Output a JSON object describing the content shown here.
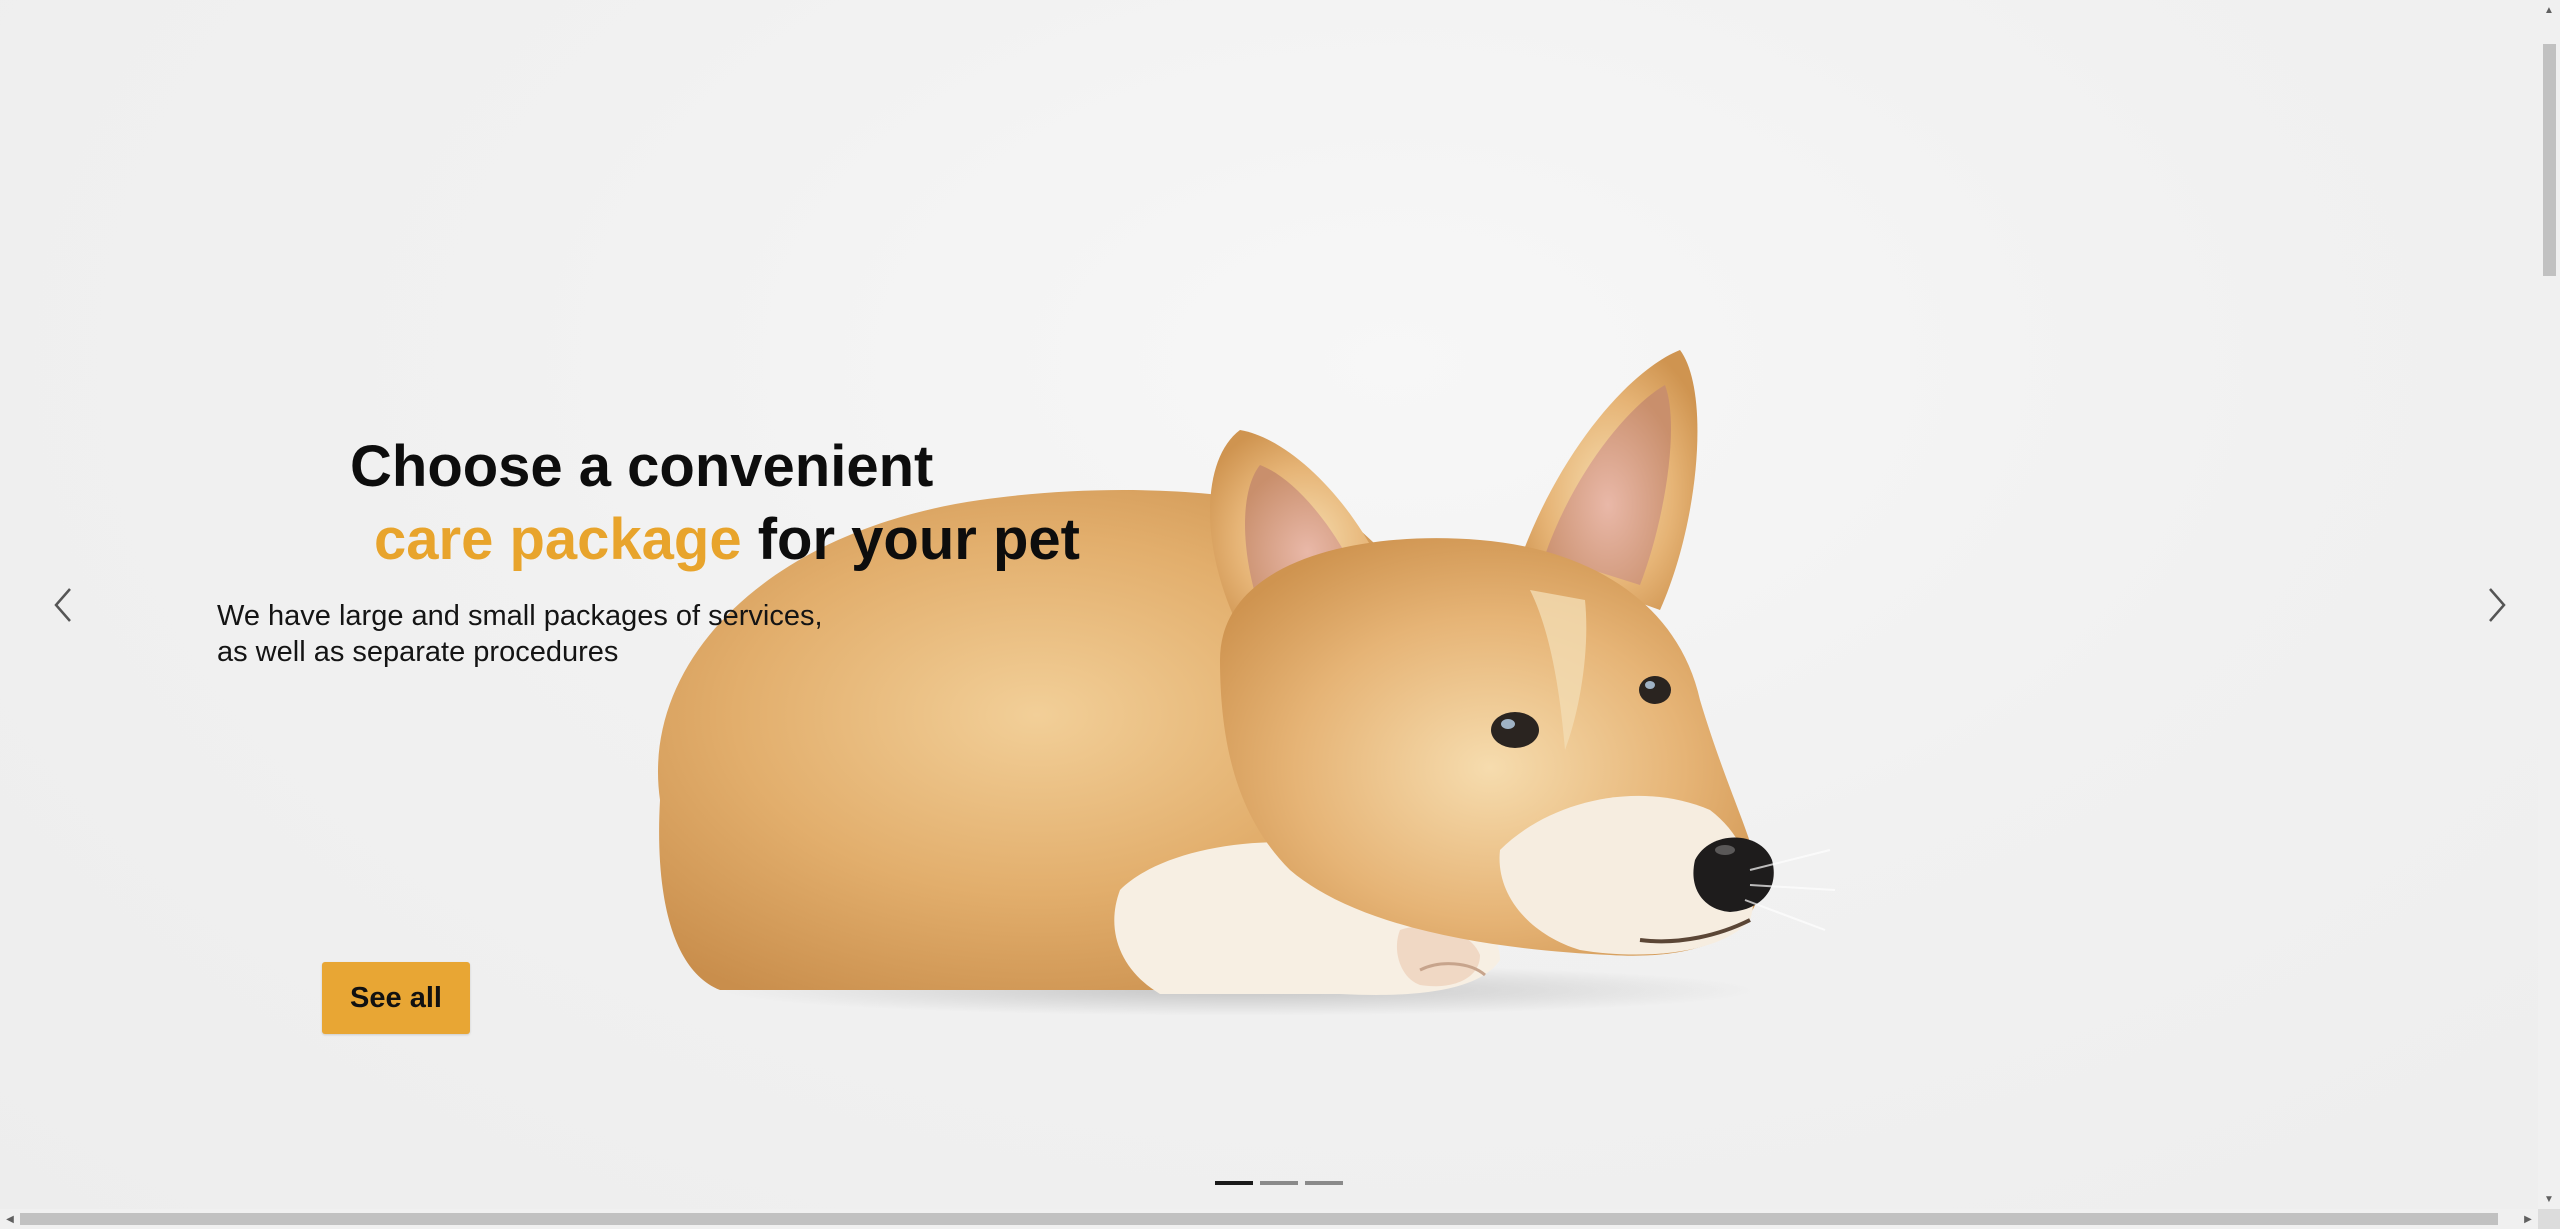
{
  "hero": {
    "title_line1": "Choose a convenient",
    "title_accent": "care package",
    "title_line2_rest": " for your pet",
    "subtitle_line1": "We have large and small packages of services,",
    "subtitle_line2": "as well as separate procedures",
    "cta_label": "See all",
    "image_icon": "corgi-photo"
  },
  "carousel": {
    "prev_icon": "chevron-left-icon",
    "next_icon": "chevron-right-icon",
    "active_index": 0,
    "slide_count": 3
  },
  "colors": {
    "accent": "#e8a42c",
    "cta_background": "#e8a634",
    "text": "#0d0d0d",
    "background": "#f2f2f2"
  }
}
